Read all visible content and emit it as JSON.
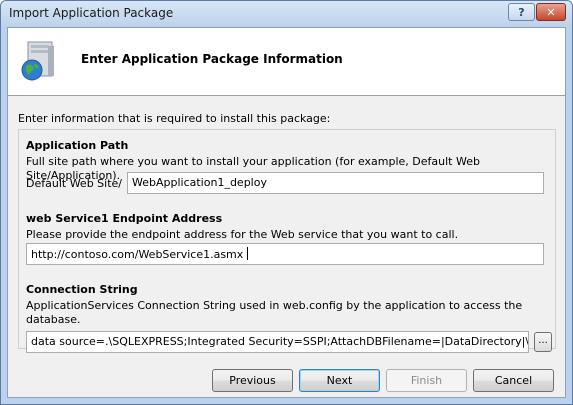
{
  "window": {
    "title": "Import Application Package",
    "help_label": "?",
    "close_label": "✕"
  },
  "header": {
    "title": "Enter Application Package Information",
    "icon": "package-globe-icon"
  },
  "intro": "Enter information that is required to install this package:",
  "app_path": {
    "title": "Application Path",
    "description": "Full site path where you want to install your application (for example, Default Web Site/Application).",
    "site_label": "Default Web Site/",
    "value": "WebApplication1_deploy"
  },
  "endpoint": {
    "title": "web Service1 Endpoint Address",
    "description": "Please provide the endpoint address for the Web service that you want to call.",
    "value": "http://contoso.com/WebService1.asmx"
  },
  "connection": {
    "title": "Connection String",
    "description": "ApplicationServices Connection String used in web.config by the application to access the database.",
    "value": "data source=.\\SQLEXPRESS;Integrated Security=SSPI;AttachDBFilename=|DataDirectory|\\aspn...",
    "browse_label": "..."
  },
  "buttons": {
    "previous": "Previous",
    "next": "Next",
    "finish": "Finish",
    "cancel": "Cancel"
  }
}
